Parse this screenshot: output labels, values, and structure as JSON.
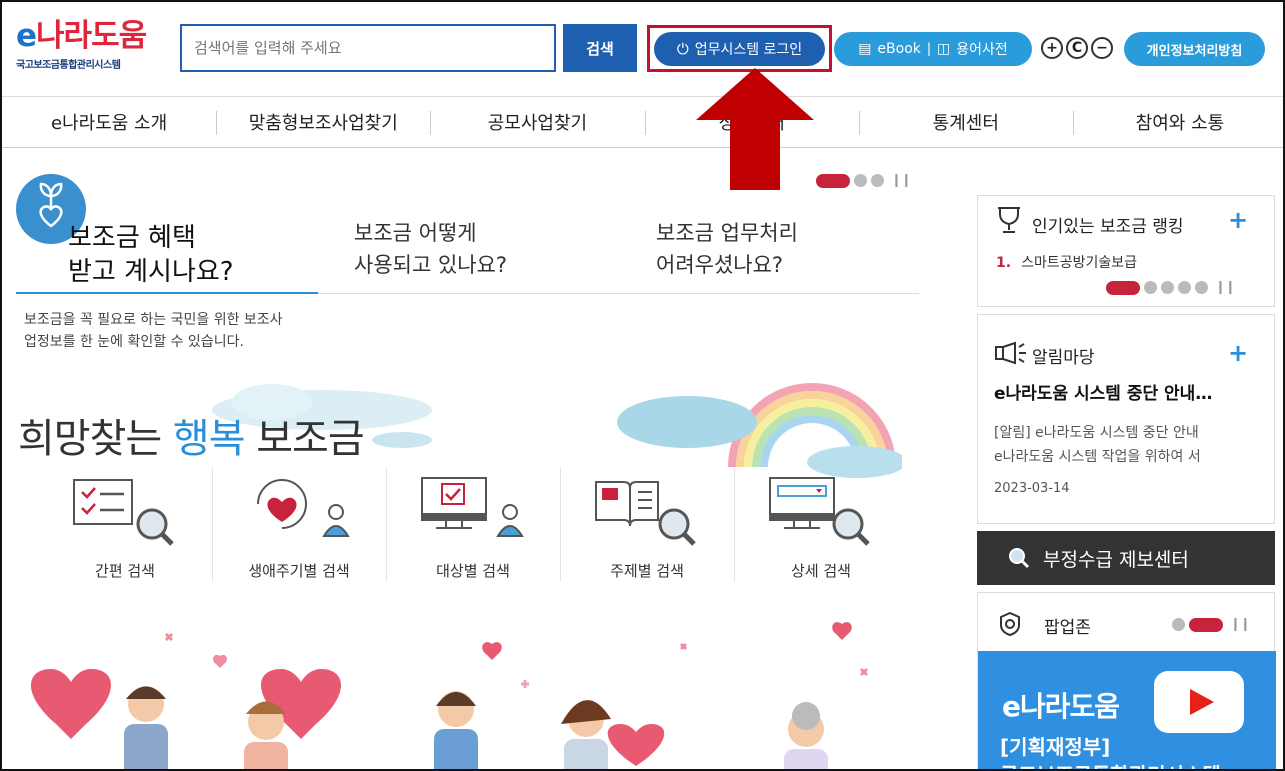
{
  "header": {
    "logo_e": "e",
    "logo_kor": "나라도움",
    "logo_sub": "국고보조금통합관리시스템",
    "search_placeholder": "검색어를 입력해 주세요",
    "search_button": "검색",
    "login_label": "업무시스템 로그인",
    "ebook_label": "eBook",
    "dictionary_label": "용어사전",
    "zoom_in": "+",
    "zoom_reset": "C",
    "zoom_out": "−",
    "privacy_label": "개인정보처리방침"
  },
  "nav": {
    "items": [
      "e나라도움 소개",
      "맞춤형보조사업찾기",
      "공모사업찾기",
      "정보공개",
      "통계센터",
      "참여와 소통"
    ]
  },
  "main": {
    "tabs": [
      {
        "line1": "보조금 혜택",
        "line2": "받고 계시나요?"
      },
      {
        "line1": "보조금 어떻게",
        "line2": "사용되고 있나요?"
      },
      {
        "line1": "보조금 업무처리",
        "line2": "어려우셨나요?"
      }
    ],
    "description": "보조금을 꼭 필요로 하는 국민을 위한 보조사업정보를 한 눈에 확인할 수 있습니다.",
    "slogan_pre": "희망찾는 ",
    "slogan_hl": "행복",
    "slogan_post": " 보조금",
    "categories": [
      "간편 검색",
      "생애주기별 검색",
      "대상별 검색",
      "주제별 검색",
      "상세 검색"
    ]
  },
  "sidebar": {
    "ranking_title": "인기있는 보조금 랭킹",
    "ranking_item_num": "1.",
    "ranking_item": "스마트공방기술보급",
    "notice_title": "알림마당",
    "notice_headline": "e나라도움 시스템 중단 안내…",
    "notice_body_1": "[알림] e나라도움 시스템 중단 안내",
    "notice_body_2": "e나라도움 시스템 작업을 위하여 서",
    "notice_date": "2023-03-14",
    "report_label": "부정수급 제보센터",
    "popup_title": "팝업존",
    "popup_logo": "e나라도움",
    "popup_line1": "[기획재정부]",
    "popup_line2": "국고보조금통합관리시스템"
  },
  "colors": {
    "primary": "#1f5fb0",
    "accent_blue": "#2a9bdb",
    "accent_red": "#c8233c",
    "highlight_box": "#c8102e"
  }
}
